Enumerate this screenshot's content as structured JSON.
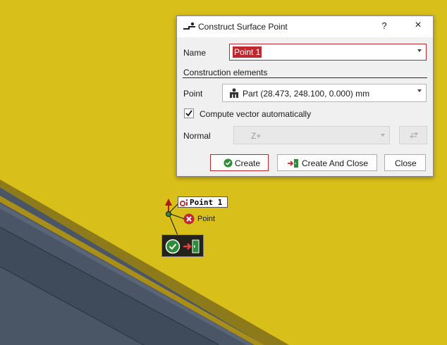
{
  "dialog": {
    "title": "Construct Surface Point",
    "help_label": "?",
    "close_label": "×",
    "name_label": "Name",
    "name_value": "Point 1",
    "section_label": "Construction elements",
    "point_label": "Point",
    "point_value": "Part (28.473, 248.100, 0.000) mm",
    "compute_vector_label": "Compute vector automatically",
    "compute_vector_checked": true,
    "normal_label": "Normal",
    "normal_value": "Z+",
    "buttons": {
      "create": "Create",
      "create_and_close": "Create And Close",
      "close": "Close"
    }
  },
  "viewport": {
    "point_label": "Point 1",
    "error_label": "Point"
  },
  "colors": {
    "background_yellow": "#d9bf1a",
    "surface_dark": "#4a5566",
    "accent_red": "#c0282f",
    "ok_green": "#2e8b3a"
  },
  "icons": [
    "point-construct-icon",
    "help-icon",
    "close-icon",
    "part-icon",
    "checkmark-icon",
    "swap-icon",
    "create-check-icon",
    "create-close-icon",
    "point-marker-icon",
    "error-icon",
    "confirm-icon",
    "exit-icon"
  ]
}
